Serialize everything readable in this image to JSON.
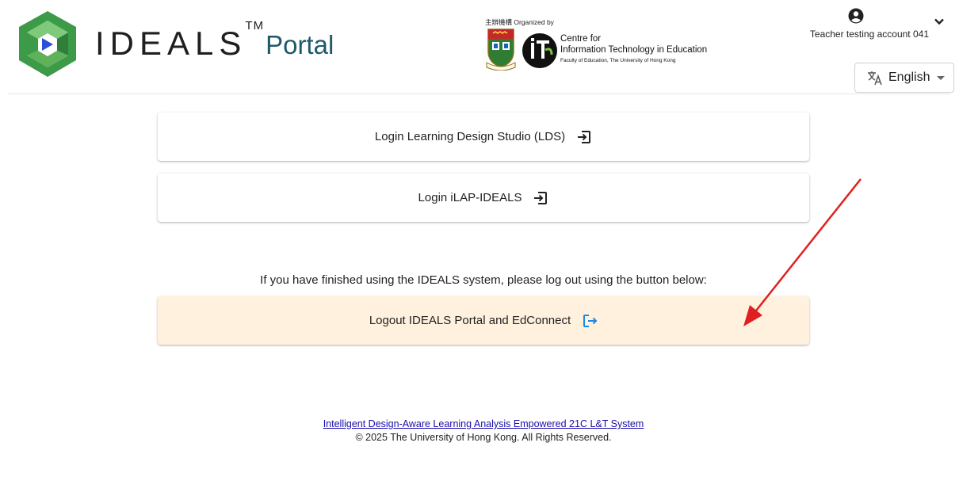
{
  "header": {
    "brand_name": "IDEALS",
    "brand_tm": "TM",
    "brand_suffix": "Portal",
    "organizer": {
      "label": "主辦機構 Organized by",
      "line1": "Centre for",
      "line2": "Information Technology in Education",
      "line3": "Faculty of Education, The University of Hong Kong"
    },
    "account": {
      "name": "Teacher testing account 041",
      "icon": "account-circle-icon"
    },
    "language": {
      "selected": "English",
      "icon": "translate-icon"
    }
  },
  "main": {
    "lds_label": "Login Learning Design Studio (LDS)",
    "ilap_label": "Login iLAP-IDEALS",
    "logout_notice": "If you have finished using the IDEALS system, please log out using the button below:",
    "logout_label": "Logout IDEALS Portal and EdConnect"
  },
  "footer": {
    "link": "Intelligent Design-Aware Learning Analysis Empowered 21C L&T System",
    "copyright": "© 2025 The University of Hong Kong. All Rights Reserved."
  },
  "colors": {
    "logo_green": "#3c9a48",
    "logo_blue": "#2b4fd6",
    "portal_text": "#1f5a6b",
    "logout_bg": "#fff1de",
    "logout_icon": "#1e88e5",
    "annotation_arrow": "#e02020",
    "link": "#1a0dab"
  }
}
